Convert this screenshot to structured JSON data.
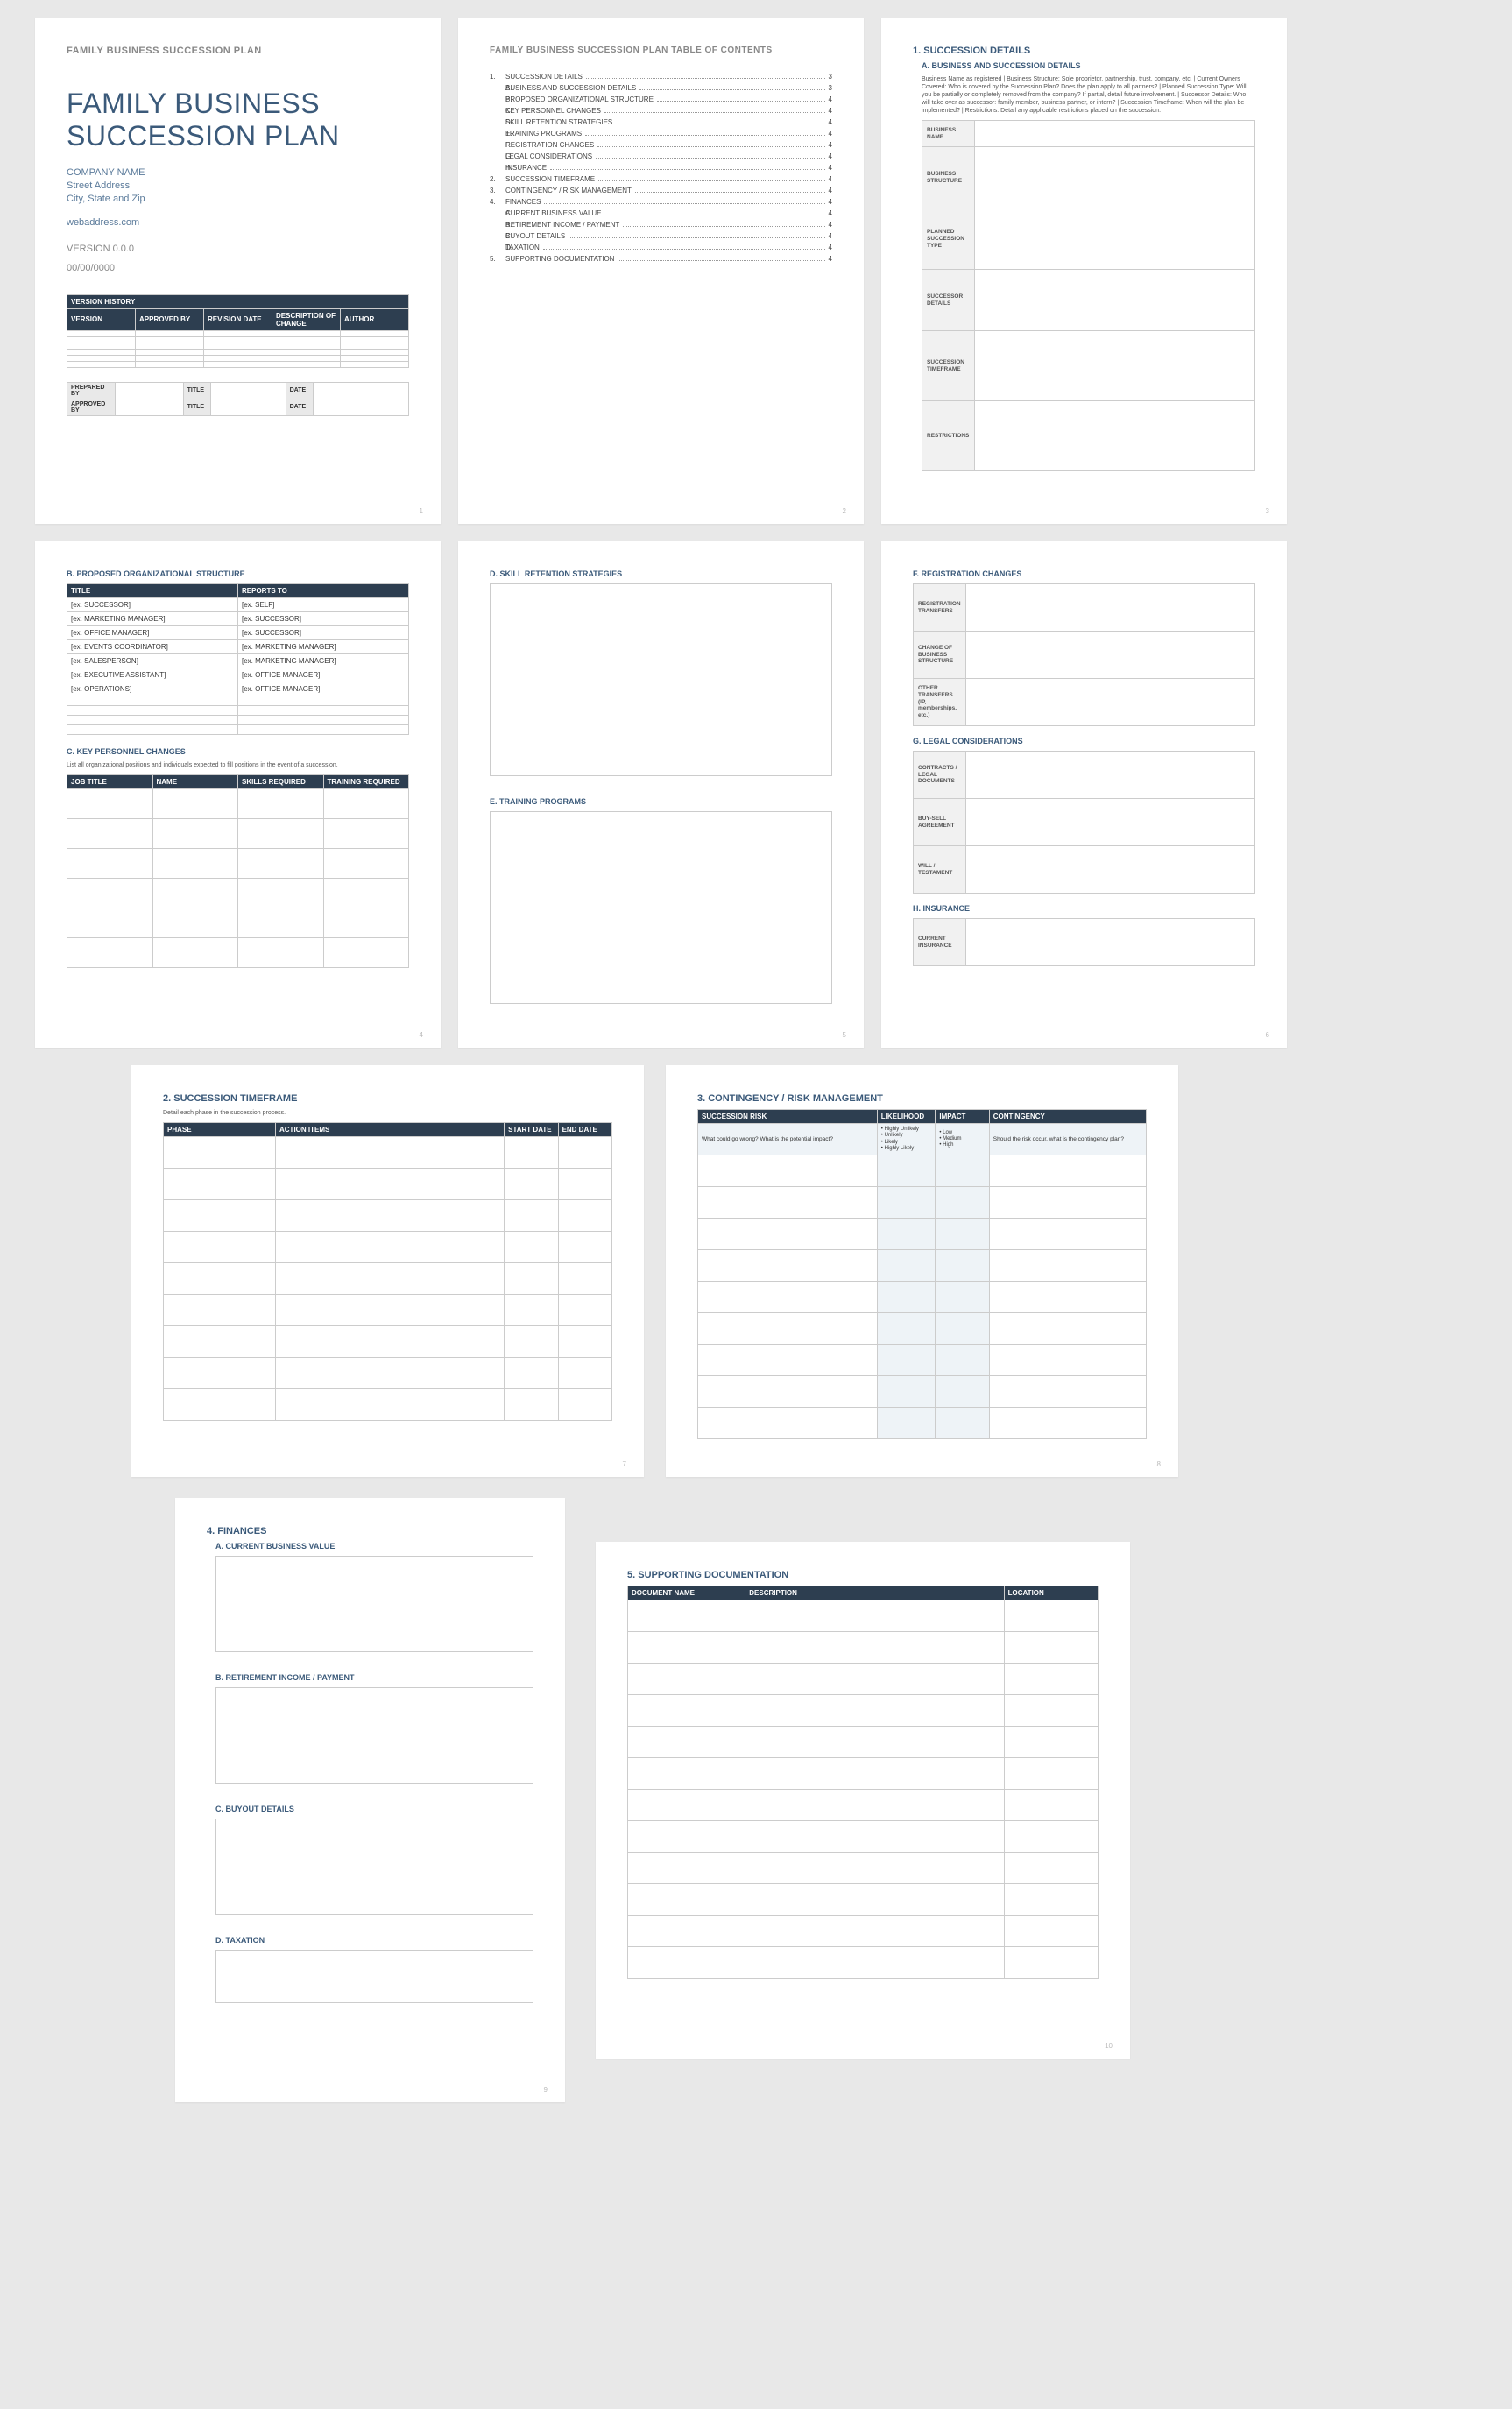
{
  "page1": {
    "header": "FAMILY BUSINESS SUCCESSION PLAN",
    "title": "FAMILY BUSINESS SUCCESSION PLAN",
    "company": "COMPANY NAME",
    "addr1": "Street Address",
    "addr2": "City, State and Zip",
    "web": "webaddress.com",
    "version": "VERSION 0.0.0",
    "date": "00/00/0000",
    "vh_title": "VERSION HISTORY",
    "vh_h1": "VERSION",
    "vh_h2": "APPROVED BY",
    "vh_h3": "REVISION DATE",
    "vh_h4": "DESCRIPTION OF CHANGE",
    "vh_h5": "AUTHOR",
    "s_prep": "PREPARED BY",
    "s_title": "TITLE",
    "s_date": "DATE",
    "s_appr": "APPROVED BY",
    "pgno": "1"
  },
  "page2": {
    "header": "FAMILY BUSINESS SUCCESSION PLAN TABLE OF CONTENTS",
    "rows": [
      {
        "n": "1.",
        "t": "SUCCESSION DETAILS",
        "p": "3"
      },
      {
        "n": "A.",
        "t": "BUSINESS AND SUCCESSION DETAILS",
        "p": "3"
      },
      {
        "n": "B.",
        "t": "PROPOSED ORGANIZATIONAL STRUCTURE",
        "p": "4"
      },
      {
        "n": "C.",
        "t": "KEY PERSONNEL CHANGES",
        "p": "4"
      },
      {
        "n": "D.",
        "t": "SKILL RETENTION STRATEGIES",
        "p": "4"
      },
      {
        "n": "E.",
        "t": "TRAINING PROGRAMS",
        "p": "4"
      },
      {
        "n": "F.",
        "t": "REGISTRATION CHANGES",
        "p": "4"
      },
      {
        "n": "G.",
        "t": "LEGAL CONSIDERATIONS",
        "p": "4"
      },
      {
        "n": "H.",
        "t": "INSURANCE",
        "p": "4"
      },
      {
        "n": "2.",
        "t": "SUCCESSION TIMEFRAME",
        "p": "4"
      },
      {
        "n": "3.",
        "t": "CONTINGENCY / RISK MANAGEMENT",
        "p": "4"
      },
      {
        "n": "4.",
        "t": "FINANCES",
        "p": "4"
      },
      {
        "n": "A.",
        "t": "CURRENT BUSINESS VALUE",
        "p": "4"
      },
      {
        "n": "B.",
        "t": "RETIREMENT INCOME / PAYMENT",
        "p": "4"
      },
      {
        "n": "C.",
        "t": "BUYOUT DETAILS",
        "p": "4"
      },
      {
        "n": "D.",
        "t": "TAXATION",
        "p": "4"
      },
      {
        "n": "5.",
        "t": "SUPPORTING DOCUMENTATION",
        "p": "4"
      }
    ],
    "pgno": "2"
  },
  "page3": {
    "sec": "1. SUCCESSION DETAILS",
    "sub": "A.  BUSINESS AND SUCCESSION DETAILS",
    "desc": "Business Name as registered | Business Structure: Sole proprietor, partnership, trust, company, etc. | Current Owners Covered: Who is covered by the Succession Plan? Does the plan apply to all partners? | Planned Succession Type: Will you be partially or completely removed from the company? If partial, detail future involvement. | Successor Details: Who will take over as successor: family member, business partner, or intern? | Succession Timeframe: When will the plan be implemented? | Restrictions: Detail any applicable restrictions placed on the succession.",
    "r1": "BUSINESS NAME",
    "r2": "BUSINESS STRUCTURE",
    "r3": "PLANNED SUCCESSION TYPE",
    "r4": "SUCCESSOR DETAILS",
    "r5": "SUCCESSION TIMEFRAME",
    "r6": "RESTRICTIONS",
    "pgno": "3"
  },
  "page4": {
    "subB": "B.  PROPOSED ORGANIZATIONAL STRUCTURE",
    "h1": "TITLE",
    "h2": "REPORTS TO",
    "rows": [
      {
        "a": "[ex. SUCCESSOR]",
        "b": "[ex. SELF]"
      },
      {
        "a": "[ex. MARKETING MANAGER]",
        "b": "[ex. SUCCESSOR]"
      },
      {
        "a": "[ex. OFFICE MANAGER]",
        "b": "[ex. SUCCESSOR]"
      },
      {
        "a": "[ex. EVENTS COORDINATOR]",
        "b": "[ex. MARKETING MANAGER]"
      },
      {
        "a": "[ex. SALESPERSON]",
        "b": "[ex. MARKETING MANAGER]"
      },
      {
        "a": "[ex. EXECUTIVE ASSISTANT]",
        "b": "[ex. OFFICE MANAGER]"
      },
      {
        "a": "[ex. OPERATIONS]",
        "b": "[ex. OFFICE MANAGER]"
      }
    ],
    "subC": "C.  KEY PERSONNEL CHANGES",
    "cdesc": "List all organizational positions and individuals expected to fill positions in the event of a succession.",
    "ch1": "JOB TITLE",
    "ch2": "NAME",
    "ch3": "SKILLS REQUIRED",
    "ch4": "TRAINING REQUIRED",
    "pgno": "4"
  },
  "page5": {
    "subD": "D.  SKILL RETENTION STRATEGIES",
    "subE": "E.  TRAINING PROGRAMS",
    "pgno": "5"
  },
  "page6": {
    "subF": "F.  REGISTRATION CHANGES",
    "f1": "REGISTRATION TRANSFERS",
    "f2": "CHANGE OF BUSINESS STRUCTURE",
    "f3": "OTHER TRANSFERS (IP, memberships, etc.)",
    "subG": "G.  LEGAL CONSIDERATIONS",
    "g1": "CONTRACTS / LEGAL DOCUMENTS",
    "g2": "BUY-SELL AGREEMENT",
    "g3": "WILL / TESTAMENT",
    "subH": "H.  INSURANCE",
    "h1": "CURRENT INSURANCE",
    "pgno": "6"
  },
  "page7": {
    "sec": "2.  SUCCESSION TIMEFRAME",
    "desc": "Detail each phase in the succession process.",
    "h1": "PHASE",
    "h2": "ACTION ITEMS",
    "h3": "START DATE",
    "h4": "END DATE",
    "pgno": "7"
  },
  "page8": {
    "sec": "3.  CONTINGENCY / RISK MANAGEMENT",
    "h1": "SUCCESSION RISK",
    "h2": "LIKELIHOOD",
    "h3": "IMPACT",
    "h4": "CONTINGENCY",
    "row1": "What could go wrong? What is the potential impact?",
    "l1": "• Highly Unlikely",
    "l2": "• Unlikely",
    "l3": "• Likely",
    "l4": "• Highly Likely",
    "i1": "• Low",
    "i2": "• Medium",
    "i3": "• High",
    "c1": "Should the risk occur, what is the contingency plan?",
    "pgno": "8"
  },
  "page9": {
    "sec": "4.  FINANCES",
    "a": "A.  CURRENT BUSINESS VALUE",
    "b": "B.  RETIREMENT INCOME / PAYMENT",
    "c": "C.  BUYOUT DETAILS",
    "d": "D.  TAXATION",
    "pgno": "9"
  },
  "page10": {
    "sec": "5.  SUPPORTING DOCUMENTATION",
    "h1": "DOCUMENT NAME",
    "h2": "DESCRIPTION",
    "h3": "LOCATION",
    "pgno": "10"
  }
}
